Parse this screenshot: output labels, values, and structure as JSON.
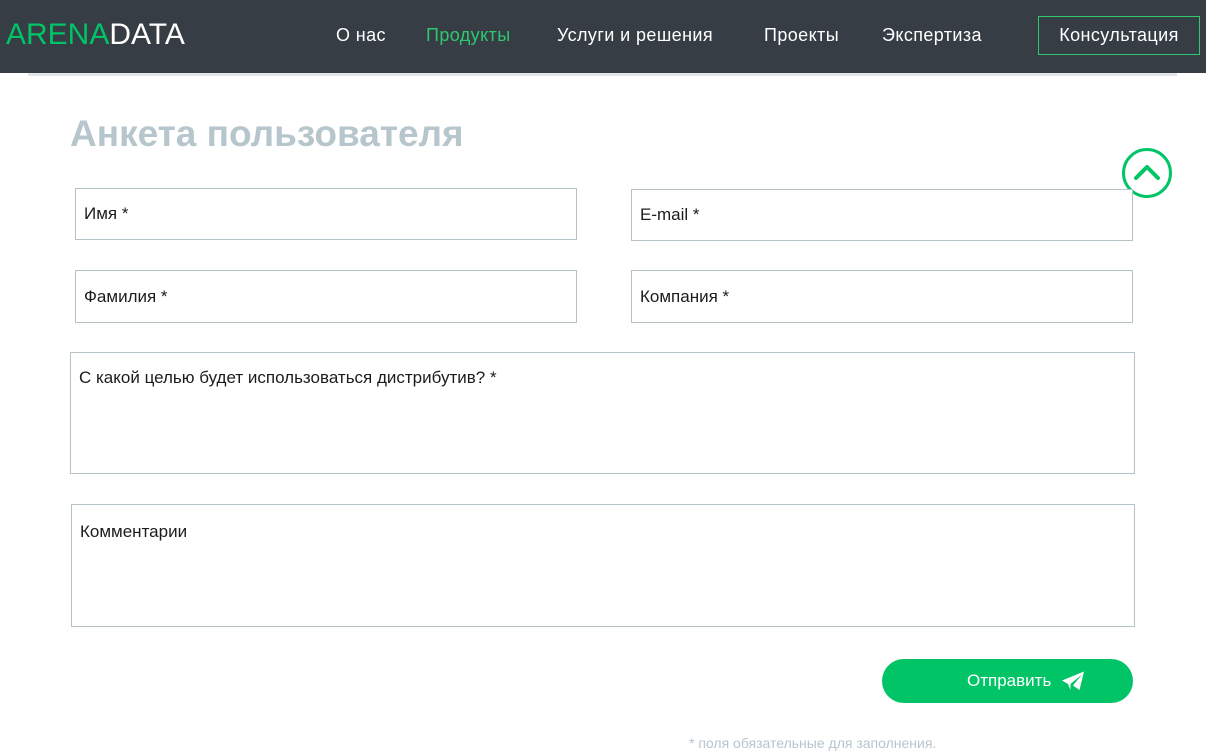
{
  "header": {
    "logo": {
      "arena": "ARENA",
      "data": "DATA"
    },
    "nav": [
      {
        "label": "О нас",
        "active": false
      },
      {
        "label": "Продукты",
        "active": true
      },
      {
        "label": "Услуги и решения",
        "active": false
      },
      {
        "label": "Проекты",
        "active": false
      },
      {
        "label": "Экспертиза",
        "active": false
      }
    ],
    "cta_label": "Консультация"
  },
  "form": {
    "title": "Анкета пользователя",
    "fields": {
      "first_name": "Имя *",
      "email": "E-mail *",
      "last_name": "Фамилия *",
      "company": "Компания *",
      "purpose": "С какой целью будет использоваться дистрибутив? *",
      "comments": "Комментарии"
    },
    "submit_label": "Отправить",
    "required_note": "* поля обязательные для заполнения."
  },
  "icons": {
    "scroll_top": "chevron-up-icon",
    "submit": "paper-plane-icon"
  },
  "colors": {
    "navbar_bg": "#363d45",
    "brand_green": "#00c466",
    "active_nav": "#2ec96f",
    "title_gray": "#b6c6cc",
    "field_border": "#b5c3c9"
  }
}
